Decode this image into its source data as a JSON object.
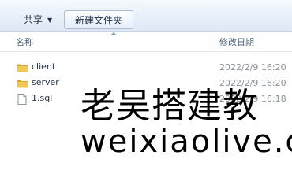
{
  "toolbar": {
    "share_label": "共享",
    "new_folder_label": "新建文件夹"
  },
  "columns": {
    "name": "名称",
    "date_modified": "修改日期"
  },
  "files": [
    {
      "name": "client",
      "date": "2022/2/9 16:20",
      "type": "folder"
    },
    {
      "name": "server",
      "date": "2022/2/9 16:20",
      "type": "folder"
    },
    {
      "name": "1.sql",
      "date": "2022/2/9 16:18",
      "type": "file"
    }
  ],
  "watermark": {
    "line1": "老吴搭建教",
    "line2": "weixiaolive.c"
  },
  "colors": {
    "folder": "#e7b93c",
    "toolbar_bg": "#eaf1fa"
  }
}
